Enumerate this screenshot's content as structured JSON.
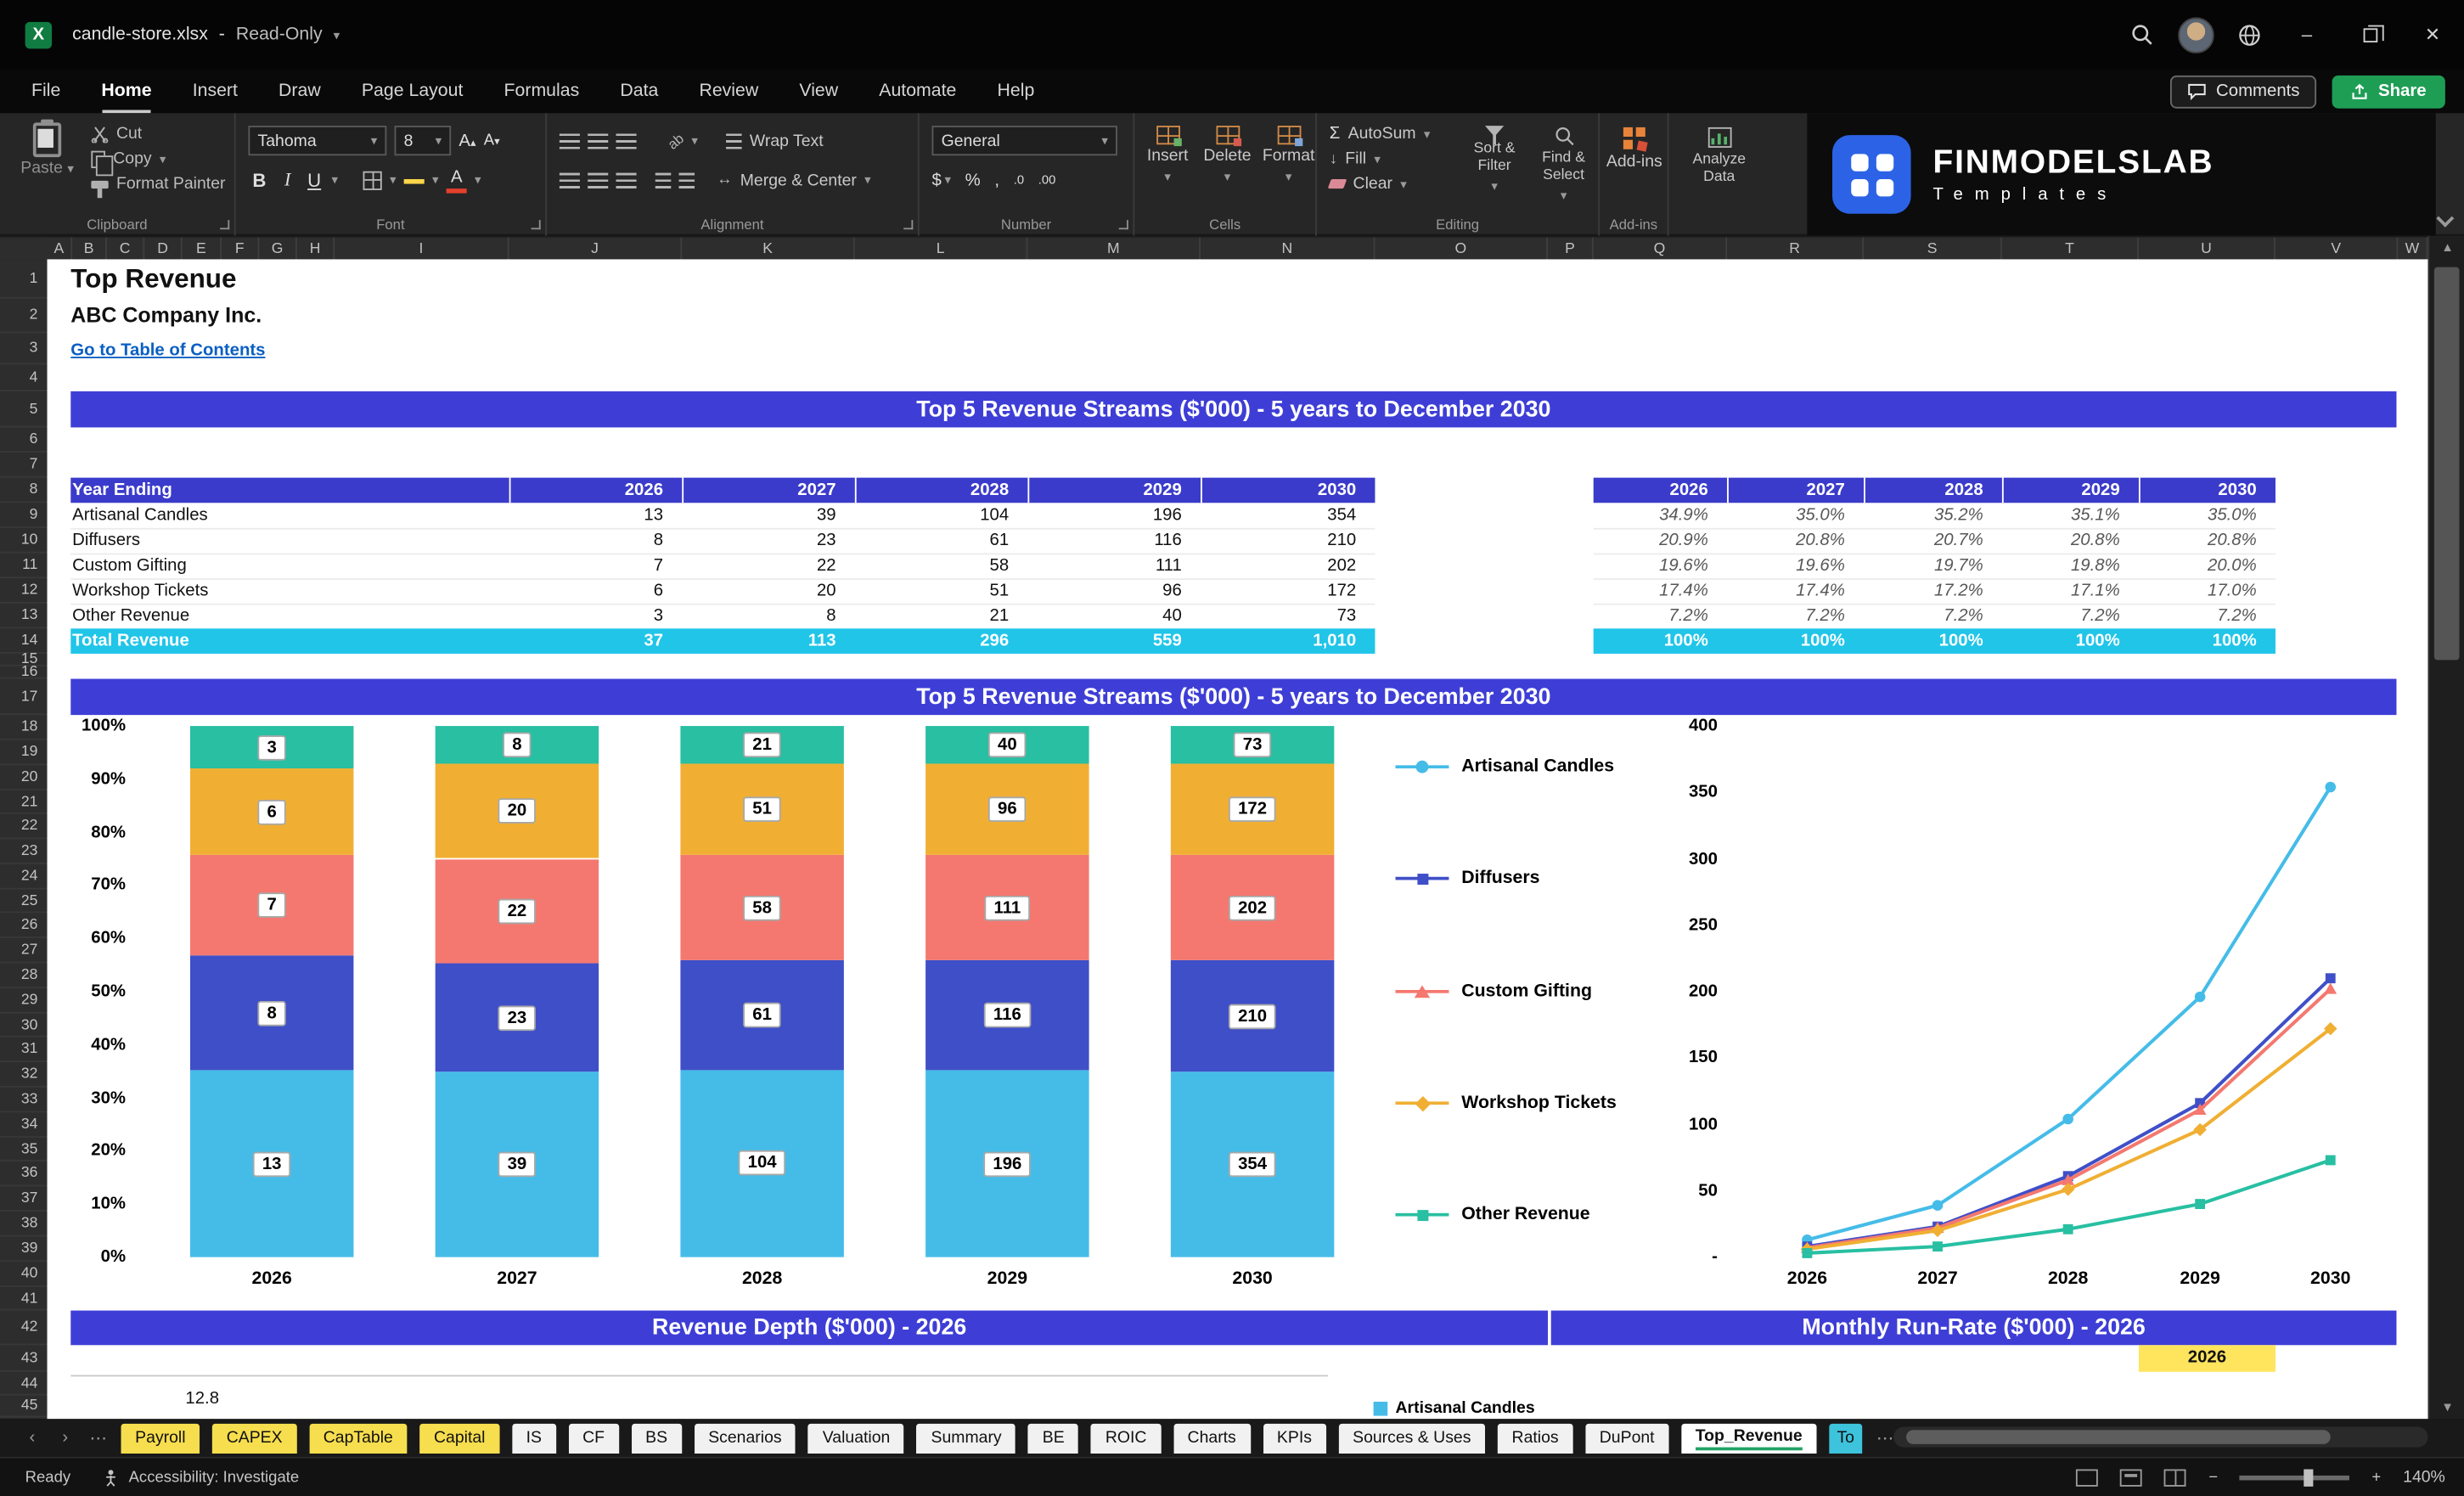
{
  "window": {
    "title": "candle-store.xlsx",
    "separator": "-",
    "mode": "Read-Only"
  },
  "icons": {
    "minimize": "–",
    "close": "✕",
    "chevron_down": "▾",
    "search": "magnifier",
    "account": "user-avatar",
    "network": "globe"
  },
  "menubar": {
    "items": [
      "File",
      "Home",
      "Insert",
      "Draw",
      "Page Layout",
      "Formulas",
      "Data",
      "Review",
      "View",
      "Automate",
      "Help"
    ],
    "active": "Home",
    "comments": "Comments",
    "share": "Share"
  },
  "ribbon": {
    "group_clipboard": "Clipboard",
    "paste": "Paste",
    "cut": "Cut",
    "copy": "Copy",
    "format_painter": "Format Painter",
    "group_font": "Font",
    "font_name": "Tahoma",
    "font_size": "8",
    "group_alignment": "Alignment",
    "wrap_text": "Wrap Text",
    "merge_center": "Merge & Center",
    "group_number": "Number",
    "number_format": "General",
    "group_cells": "Cells",
    "insert": "Insert",
    "delete": "Delete",
    "format": "Format",
    "group_editing": "Editing",
    "autosum": "AutoSum",
    "fill": "Fill",
    "clear": "Clear",
    "sort_filter": "Sort & Filter",
    "find_select": "Find & Select",
    "group_addins": "Add-ins",
    "addins": "Add-ins",
    "analyze_data": "Analyze Data"
  },
  "brand": {
    "name": "FINMODELSLAB",
    "tagline": "Templates"
  },
  "grid": {
    "columns": [
      "A",
      "B",
      "C",
      "D",
      "E",
      "F",
      "G",
      "H",
      "I",
      "J",
      "K",
      "L",
      "M",
      "N",
      "O",
      "P",
      "Q",
      "R",
      "S",
      "T",
      "U",
      "V",
      "W"
    ],
    "row_count": 45
  },
  "sheet": {
    "title": "Top Revenue",
    "subtitle": "ABC Company Inc.",
    "link": "Go to Table of Contents",
    "section1_title": "Top 5 Revenue Streams ($'000) - 5 years to December 2030",
    "section2_title": "Top 5 Revenue Streams ($'000) - 5 years to December 2030",
    "section3_title": "Revenue Depth ($'000) - 2026",
    "section4_title": "Monthly Run-Rate ($'000) - 2026",
    "table": {
      "row_header": "Year Ending",
      "years": [
        "2026",
        "2027",
        "2028",
        "2029",
        "2030"
      ],
      "rows": [
        {
          "label": "Artisanal Candles",
          "values": [
            "13",
            "39",
            "104",
            "196",
            "354"
          ],
          "pcts": [
            "34.9%",
            "35.0%",
            "35.2%",
            "35.1%",
            "35.0%"
          ]
        },
        {
          "label": "Diffusers",
          "values": [
            "8",
            "23",
            "61",
            "116",
            "210"
          ],
          "pcts": [
            "20.9%",
            "20.8%",
            "20.7%",
            "20.8%",
            "20.8%"
          ]
        },
        {
          "label": "Custom Gifting",
          "values": [
            "7",
            "22",
            "58",
            "111",
            "202"
          ],
          "pcts": [
            "19.6%",
            "19.6%",
            "19.7%",
            "19.8%",
            "20.0%"
          ]
        },
        {
          "label": "Workshop Tickets",
          "values": [
            "6",
            "20",
            "51",
            "96",
            "172"
          ],
          "pcts": [
            "17.4%",
            "17.4%",
            "17.2%",
            "17.1%",
            "17.0%"
          ]
        },
        {
          "label": "Other Revenue",
          "values": [
            "3",
            "8",
            "21",
            "40",
            "73"
          ],
          "pcts": [
            "7.2%",
            "7.2%",
            "7.2%",
            "7.2%",
            "7.2%"
          ]
        }
      ],
      "total": {
        "label": "Total Revenue",
        "values": [
          "37",
          "113",
          "296",
          "559",
          "1,010"
        ],
        "pcts": [
          "100%",
          "100%",
          "100%",
          "100%",
          "100%"
        ]
      }
    },
    "runrate_cell": "2026",
    "partial_axis_value": "12.8",
    "partial_legend": "Artisanal Candles"
  },
  "chart_data": [
    {
      "type": "bar",
      "subtype": "stacked-100pct",
      "title": "Top 5 Revenue Streams ($'000) - 5 years to December 2030",
      "categories": [
        "2026",
        "2027",
        "2028",
        "2029",
        "2030"
      ],
      "series": [
        {
          "name": "Artisanal Candles",
          "color": "#45BCE8",
          "values": [
            13,
            39,
            104,
            196,
            354
          ]
        },
        {
          "name": "Diffusers",
          "color": "#3F4FC8",
          "values": [
            8,
            23,
            61,
            116,
            210
          ]
        },
        {
          "name": "Custom Gifting",
          "color": "#F4786F",
          "values": [
            7,
            22,
            58,
            111,
            202
          ]
        },
        {
          "name": "Workshop Tickets",
          "color": "#F0AF33",
          "values": [
            6,
            20,
            51,
            96,
            172
          ]
        },
        {
          "name": "Other Revenue",
          "color": "#28BFA2",
          "values": [
            3,
            8,
            21,
            40,
            73
          ]
        }
      ],
      "y_ticks": [
        "100%",
        "90%",
        "80%",
        "70%",
        "60%",
        "50%",
        "40%",
        "30%",
        "20%",
        "10%",
        "0%"
      ],
      "ylim": [
        0,
        1
      ],
      "grid": false,
      "legend_position": "right",
      "data_labels": true
    },
    {
      "type": "line",
      "categories": [
        "2026",
        "2027",
        "2028",
        "2029",
        "2030"
      ],
      "series": [
        {
          "name": "Artisanal Candles",
          "color": "#45BCE8",
          "marker": "circle",
          "values": [
            13,
            39,
            104,
            196,
            354
          ]
        },
        {
          "name": "Diffusers",
          "color": "#3F4FC8",
          "marker": "square",
          "values": [
            8,
            23,
            61,
            116,
            210
          ]
        },
        {
          "name": "Custom Gifting",
          "color": "#F4786F",
          "marker": "triangle",
          "values": [
            7,
            22,
            58,
            111,
            202
          ]
        },
        {
          "name": "Workshop Tickets",
          "color": "#F0AF33",
          "marker": "diamond",
          "values": [
            6,
            20,
            51,
            96,
            172
          ]
        },
        {
          "name": "Other Revenue",
          "color": "#28BFA2",
          "marker": "square",
          "values": [
            3,
            8,
            21,
            40,
            73
          ]
        }
      ],
      "y_ticks": [
        "400",
        "350",
        "300",
        "250",
        "200",
        "150",
        "100",
        "50",
        "-"
      ],
      "ylim": [
        0,
        400
      ],
      "grid": false
    },
    {
      "type": "bar",
      "title": "Revenue Depth ($'000) - 2026",
      "status": "partially visible"
    },
    {
      "type": "line",
      "title": "Monthly Run-Rate ($'000) - 2026",
      "status": "partially visible"
    }
  ],
  "tabbar": {
    "tabs": [
      {
        "label": "Payroll",
        "variant": "yellow"
      },
      {
        "label": "CAPEX",
        "variant": "yellow"
      },
      {
        "label": "CapTable",
        "variant": "yellow"
      },
      {
        "label": "Capital",
        "variant": "yellow"
      },
      {
        "label": "IS",
        "variant": "white"
      },
      {
        "label": "CF",
        "variant": "white"
      },
      {
        "label": "BS",
        "variant": "white"
      },
      {
        "label": "Scenarios",
        "variant": "white"
      },
      {
        "label": "Valuation",
        "variant": "white"
      },
      {
        "label": "Summary",
        "variant": "white"
      },
      {
        "label": "BE",
        "variant": "white"
      },
      {
        "label": "ROIC",
        "variant": "white"
      },
      {
        "label": "Charts",
        "variant": "white"
      },
      {
        "label": "KPIs",
        "variant": "white"
      },
      {
        "label": "Sources & Uses",
        "variant": "white"
      },
      {
        "label": "Ratios",
        "variant": "white"
      },
      {
        "label": "DuPont",
        "variant": "white"
      },
      {
        "label": "Top_Revenue",
        "variant": "active"
      },
      {
        "label": "To",
        "variant": "cyan"
      }
    ],
    "active": "Top_Revenue",
    "add": "+"
  },
  "statusbar": {
    "ready": "Ready",
    "accessibility": "Accessibility: Investigate",
    "zoom": "140%"
  },
  "colors": {
    "banner": "#3E3ED6",
    "table_header": "#3B3BCB",
    "total_row": "#20C5E8",
    "highlight_cell": "#FFE45E",
    "link": "#0A5FC2",
    "share_button": "#1E9E55",
    "tab_yellow": "#F7DE4E",
    "tab_cyan": "#3EC3DC"
  }
}
